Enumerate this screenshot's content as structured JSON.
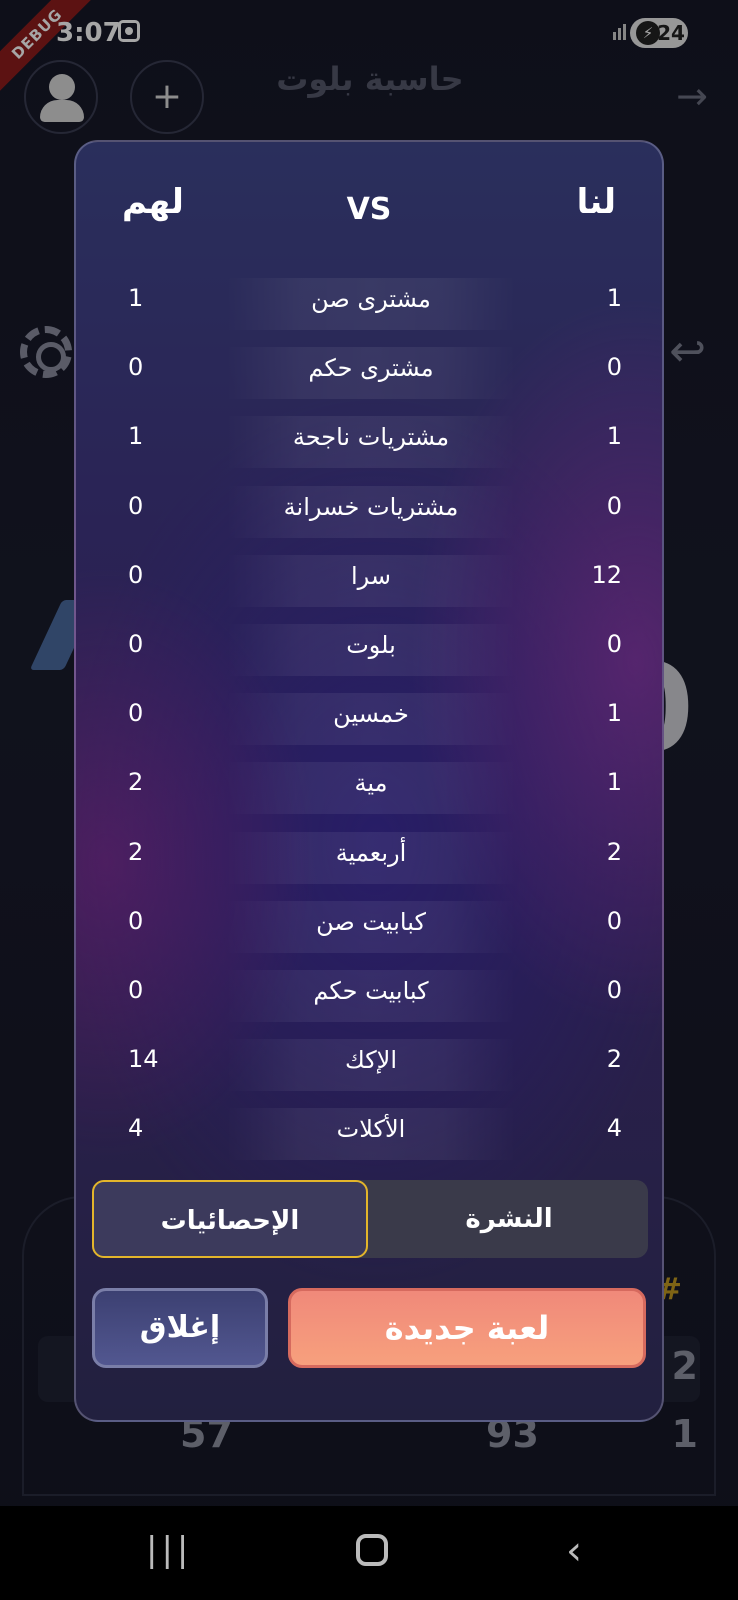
{
  "status_bar": {
    "time": "3:07",
    "debug": "DEBUG",
    "battery": "24"
  },
  "app": {
    "title": "حاسبة بلوت",
    "big_digit": "0"
  },
  "background": {
    "row_num": "2",
    "row_num2": "1",
    "score_left": "57",
    "score_mid": "93",
    "hash": "#"
  },
  "dialog": {
    "header": {
      "us": "لنا",
      "vs": "VS",
      "them": "لهم"
    },
    "stats": [
      {
        "label": "مشترى صن",
        "us": "1",
        "them": "1"
      },
      {
        "label": "مشترى حكم",
        "us": "0",
        "them": "0"
      },
      {
        "label": "مشتريات ناجحة",
        "us": "1",
        "them": "1"
      },
      {
        "label": "مشتريات خسرانة",
        "us": "0",
        "them": "0"
      },
      {
        "label": "سرا",
        "us": "12",
        "them": "0"
      },
      {
        "label": "بلوت",
        "us": "0",
        "them": "0"
      },
      {
        "label": "خمسين",
        "us": "1",
        "them": "0"
      },
      {
        "label": "مية",
        "us": "1",
        "them": "2"
      },
      {
        "label": "أربعمية",
        "us": "2",
        "them": "2"
      },
      {
        "label": "كبابيت صن",
        "us": "0",
        "them": "0"
      },
      {
        "label": "كبابيت حكم",
        "us": "0",
        "them": "0"
      },
      {
        "label": "الإكك",
        "us": "2",
        "them": "14"
      },
      {
        "label": "الأكلات",
        "us": "4",
        "them": "4"
      }
    ],
    "tabs": {
      "feed": "النشرة",
      "stats": "الإحصائيات"
    },
    "buttons": {
      "new_game": "لعبة جديدة",
      "close": "إغلاق"
    }
  },
  "colors": {
    "accent_gold": "#e3b52b",
    "new_game": "#f7a07d",
    "close": "#525790"
  }
}
